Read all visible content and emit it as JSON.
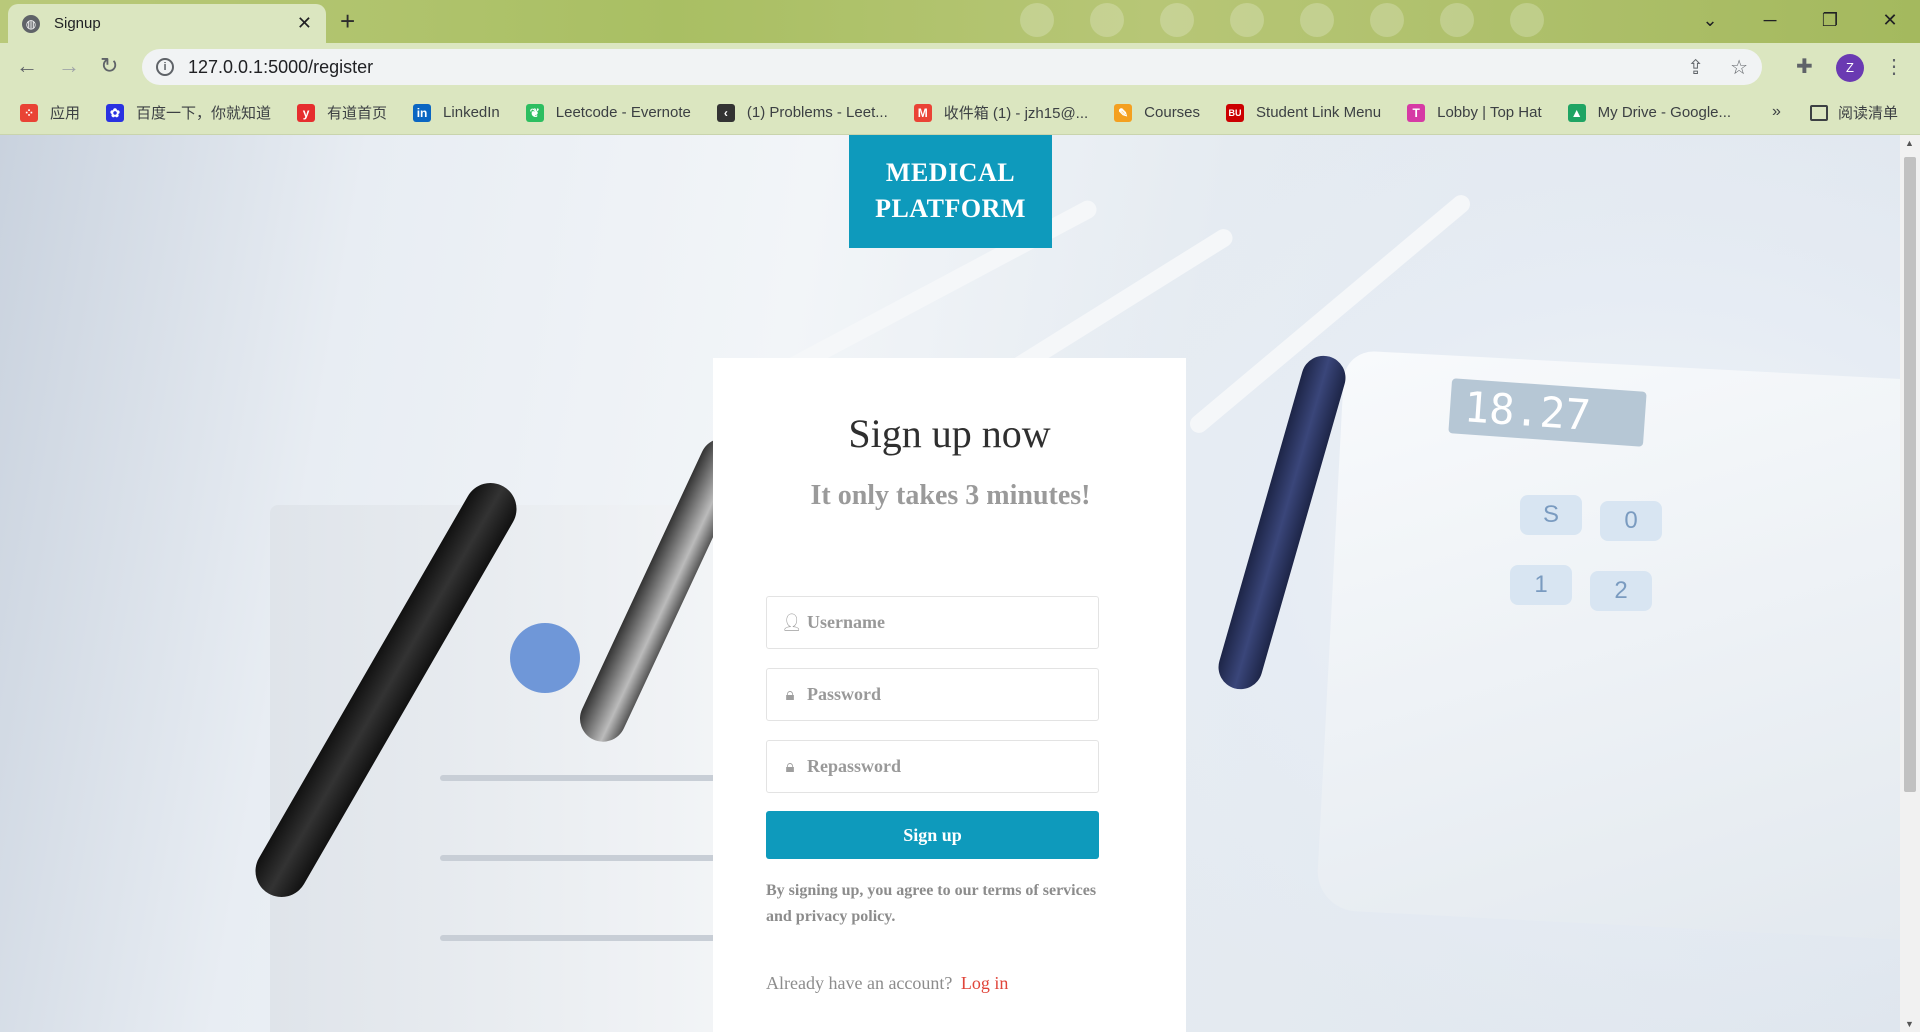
{
  "browser": {
    "tab_title": "Signup",
    "url": "127.0.0.1:5000/register",
    "profile_initial": "Z",
    "bookmarks": [
      {
        "label": "应用",
        "icon": "apps-grid-icon",
        "color": "#e94335"
      },
      {
        "label": "百度一下，你就知道",
        "icon": "baidu-icon",
        "color": "#2932e1"
      },
      {
        "label": "有道首页",
        "icon": "youdao-icon",
        "color": "#e62e2e"
      },
      {
        "label": "LinkedIn",
        "icon": "linkedin-icon",
        "color": "#0a66c2"
      },
      {
        "label": "Leetcode - Evernote",
        "icon": "evernote-icon",
        "color": "#2dbe60"
      },
      {
        "label": "(1) Problems - Leet...",
        "icon": "leetcode-icon",
        "color": "#333333"
      },
      {
        "label": "收件箱 (1) - jzh15@...",
        "icon": "gmail-icon",
        "color": "#ea4335"
      },
      {
        "label": "Courses",
        "icon": "courses-icon",
        "color": "#f4a020"
      },
      {
        "label": "Student Link Menu",
        "icon": "bu-icon",
        "color": "#cc0000"
      },
      {
        "label": "Lobby | Top Hat",
        "icon": "tophat-icon",
        "color": "#d63aa5"
      },
      {
        "label": "My Drive - Google...",
        "icon": "google-drive-icon",
        "color": "#1fa463"
      }
    ],
    "reading_list": "阅读清单",
    "more": "»"
  },
  "page": {
    "brand": [
      "MEDICAL",
      "PLATFORM"
    ],
    "brand_color": "#0e9abc",
    "heading": "Sign up now",
    "subheading": "It only takes 3 minutes!",
    "fields": {
      "username_placeholder": "Username",
      "password_placeholder": "Password",
      "repassword_placeholder": "Repassword"
    },
    "submit_label": "Sign up",
    "terms": "By signing up, you agree to our terms of services and privacy policy.",
    "already_text": "Already have an account?",
    "login_link": "Log in"
  },
  "backdrop": {
    "display_reading": "18.27",
    "keys": [
      "S",
      "0",
      "1",
      "2"
    ]
  }
}
